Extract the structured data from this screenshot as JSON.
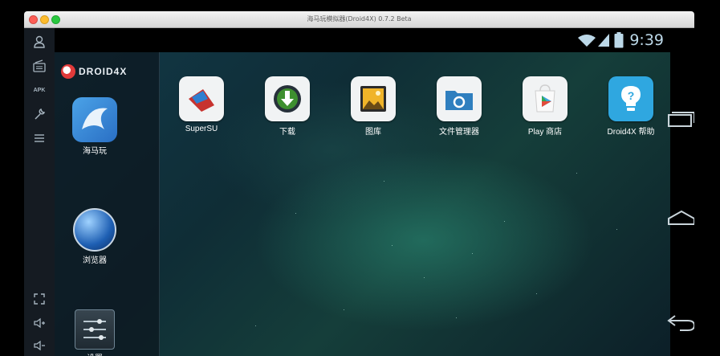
{
  "window": {
    "title": "海马玩模拟器(Droid4X) 0.7.2 Beta"
  },
  "status": {
    "time": "9:39"
  },
  "left_toolbar": {
    "top_tools": [
      {
        "icon": "user-icon"
      },
      {
        "icon": "radio-icon"
      },
      {
        "icon": "apk-install-icon",
        "text": "APK"
      },
      {
        "icon": "wrench-icon"
      },
      {
        "icon": "menu-icon"
      }
    ],
    "bottom_tools": [
      {
        "icon": "fullscreen-icon"
      },
      {
        "icon": "volume-up-icon"
      },
      {
        "icon": "volume-down-icon"
      }
    ]
  },
  "dock": {
    "brand": "DROID4X",
    "apps": [
      {
        "label": "海马玩",
        "icon": "haimawan-icon"
      },
      {
        "label": "浏览器",
        "icon": "browser-icon"
      },
      {
        "label": "设置",
        "icon": "settings-icon"
      }
    ]
  },
  "apps": [
    {
      "label": "SuperSU",
      "icon": "supersu-icon"
    },
    {
      "label": "下载",
      "icon": "download-icon"
    },
    {
      "label": "图库",
      "icon": "gallery-icon"
    },
    {
      "label": "文件管理器",
      "icon": "file-manager-icon"
    },
    {
      "label": "Play 商店",
      "icon": "play-store-icon"
    },
    {
      "label": "Droid4X 帮助",
      "icon": "help-icon"
    }
  ],
  "nav": [
    {
      "icon": "recent-apps-icon"
    },
    {
      "icon": "home-icon"
    },
    {
      "icon": "back-icon"
    }
  ],
  "colors": {
    "time_text": "#bcd8e8",
    "dock_bg": "#0c161e",
    "help_blue": "#2fa7e0",
    "download_green": "#3e8f2f"
  }
}
